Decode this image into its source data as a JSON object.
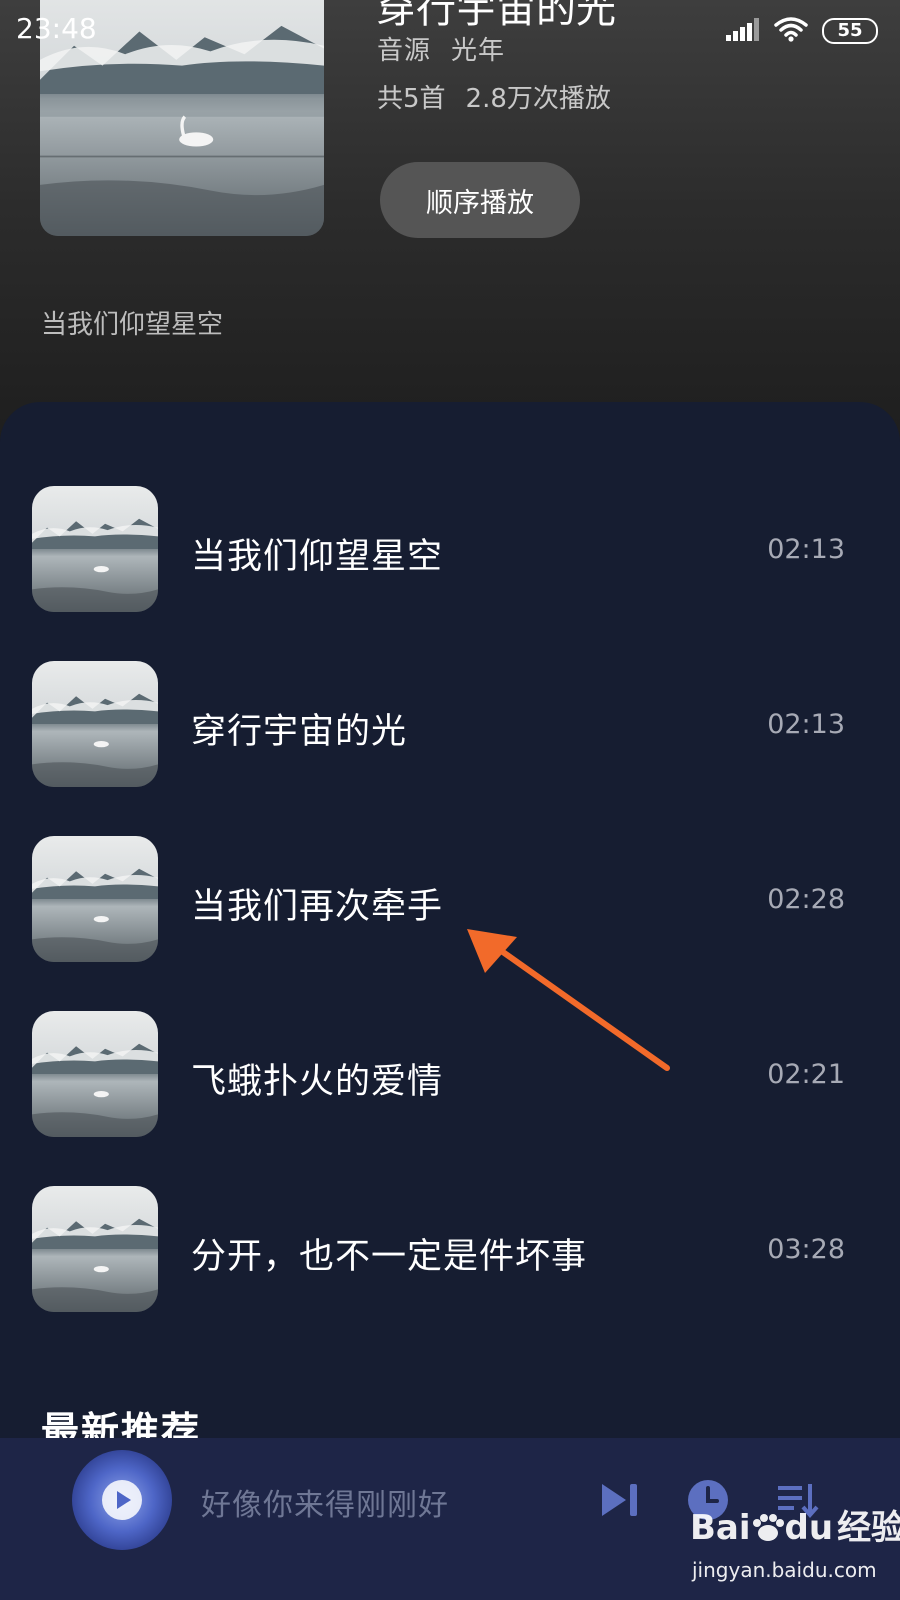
{
  "status_bar": {
    "time": "23:48",
    "battery": "55",
    "icons": [
      "signal-icon",
      "wifi-icon",
      "battery-icon"
    ]
  },
  "album": {
    "title": "穿行宇宙的光",
    "source_label": "音源",
    "source_value": "光年",
    "count": "共5首",
    "plays": "2.8万次播放",
    "play_button": "顺序播放",
    "description": "当我们仰望星空"
  },
  "tracks": [
    {
      "title": "当我们仰望星空",
      "duration": "02:13"
    },
    {
      "title": "穿行宇宙的光",
      "duration": "02:13"
    },
    {
      "title": "当我们再次牵手",
      "duration": "02:28"
    },
    {
      "title": "飞蛾扑火的爱情",
      "duration": "02:21"
    },
    {
      "title": "分开，也不一定是件坏事",
      "duration": "03:28"
    }
  ],
  "section": {
    "title": "最新推荐"
  },
  "player": {
    "song": "好像你来得刚刚好",
    "icons": [
      "play-icon",
      "skip-next-icon",
      "timer-icon",
      "playlist-icon"
    ]
  },
  "watermark": {
    "brand_a": "Bai",
    "brand_b": "du",
    "suffix": "经验",
    "url": "jingyan.baidu.com"
  },
  "colors": {
    "panel_bg": "#161d31",
    "player_bg": "#1e2547",
    "annotation_arrow": "#f26a2a"
  }
}
